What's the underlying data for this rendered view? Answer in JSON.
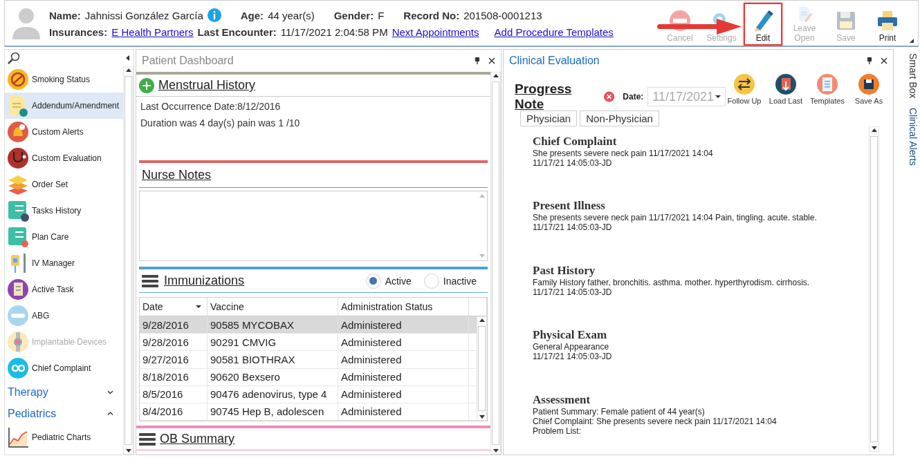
{
  "patient": {
    "name_label": "Name:",
    "name": "Jahnissi González García",
    "age_label": "Age:",
    "age": "44 year(s)",
    "gender_label": "Gender:",
    "gender": "F",
    "record_label": "Record No:",
    "record": "201508-0001213",
    "insurances_label": "Insurances:",
    "insurance": "E Health Partners",
    "last_encounter_label": "Last Encounter:",
    "last_encounter": "11/17/2021 2:04:58 PM",
    "links": [
      "Next Appointments",
      "Add Procedure Templates"
    ]
  },
  "toolbar": [
    {
      "label": "Cancel",
      "disabled": true,
      "highlighted": false
    },
    {
      "label": "Settings",
      "disabled": true,
      "highlighted": false
    },
    {
      "label": "Edit",
      "disabled": false,
      "highlighted": true
    },
    {
      "label": "Leave Open",
      "disabled": true,
      "highlighted": false
    },
    {
      "label": "Save",
      "disabled": true,
      "highlighted": false
    },
    {
      "label": "Print",
      "disabled": false,
      "highlighted": false
    }
  ],
  "sidebar": {
    "items": [
      {
        "label": "Smoking Status",
        "selected": false,
        "disabled": false
      },
      {
        "label": "Addendum/Amendment",
        "selected": true,
        "disabled": false
      },
      {
        "label": "Custom Alerts",
        "selected": false,
        "disabled": false
      },
      {
        "label": "Custom Evaluation",
        "selected": false,
        "disabled": false
      },
      {
        "label": "Order Set",
        "selected": false,
        "disabled": false
      },
      {
        "label": "Tasks History",
        "selected": false,
        "disabled": false
      },
      {
        "label": "Plan Care",
        "selected": false,
        "disabled": false
      },
      {
        "label": "IV Manager",
        "selected": false,
        "disabled": false
      },
      {
        "label": "Active Task",
        "selected": false,
        "disabled": false
      },
      {
        "label": "ABG",
        "selected": false,
        "disabled": false
      },
      {
        "label": "Implantable Devices",
        "selected": false,
        "disabled": true
      },
      {
        "label": "Chief Complaint",
        "selected": false,
        "disabled": false
      }
    ],
    "groups": [
      {
        "label": "Therapy",
        "expanded": false
      },
      {
        "label": "Pediatrics",
        "expanded": true,
        "children": [
          {
            "label": "Pediatric Charts",
            "selected": false,
            "disabled": false
          }
        ]
      }
    ]
  },
  "dashboard": {
    "title": "Patient Dashboard",
    "menstrual": {
      "title": "Menstrual History",
      "lines": [
        "Last Occurrence Date:8/12/2016",
        "Duration was 4 day(s) pain was 1 /10"
      ]
    },
    "nurse_notes": {
      "title": "Nurse Notes"
    },
    "immunizations": {
      "title": "Immunizations",
      "filters": [
        {
          "label": "Active",
          "selected": true
        },
        {
          "label": "Inactive",
          "selected": false
        }
      ],
      "columns": [
        "Date",
        "Vaccine",
        "Administration Status"
      ],
      "rows": [
        {
          "cells": [
            "9/28/2016",
            "90585 MYCOBAX",
            "Administered"
          ],
          "selected": true
        },
        {
          "cells": [
            "9/28/2016",
            "90291 CMVIG",
            "Administered"
          ],
          "selected": false
        },
        {
          "cells": [
            "9/27/2016",
            "90581 BIOTHRAX",
            "Administered"
          ],
          "selected": false
        },
        {
          "cells": [
            "8/18/2016",
            "90620 Bexsero",
            "Administered"
          ],
          "selected": false
        },
        {
          "cells": [
            "8/5/2016",
            "90476 adenovirus, type 4",
            "Administered"
          ],
          "selected": false
        },
        {
          "cells": [
            "8/4/2016",
            "90745 Hep B, adolescen",
            "Administered"
          ],
          "selected": false
        }
      ]
    },
    "ob_summary": {
      "title": "OB Summary"
    }
  },
  "clinical": {
    "title": "Clinical Evaluation",
    "note_title": "Progress Note",
    "date_label": "Date:",
    "date": "11/17/2021",
    "actions": [
      "Follow Up",
      "Load Last",
      "Templates",
      "Save As"
    ],
    "tabs": [
      "Physician",
      "Non-Physician"
    ],
    "sections": [
      {
        "heading": "Chief Complaint",
        "lines": [
          "She presents severe neck pain 11/17/2021 14:04",
          "11/17/21 14:05:03-JD"
        ]
      },
      {
        "heading": "Present Illness",
        "lines": [
          "She presents severe neck pain 11/17/2021 14:04 Pain, tingling. acute. stable.",
          "11/17/21 14:05:03-JD"
        ]
      },
      {
        "heading": "Past History",
        "lines": [
          "Family History father, bronchitis. asthma. mother. hyperthyrodism. cirrhosis.",
          "11/17/21 14:05:03-JD"
        ]
      },
      {
        "heading": "Physical Exam",
        "lines": [
          "General Appearance",
          "11/17/21 14:05:03-JD"
        ]
      },
      {
        "heading": "Assessment",
        "lines": [
          "Patient Summary: Female patient of 44 year(s)",
          "Chief Complaint: She presents severe neck pain 11/17/2021 14:04",
          "Problem List:"
        ]
      }
    ]
  },
  "right_rail": [
    "Smart Box",
    "Clinical Alerts"
  ]
}
